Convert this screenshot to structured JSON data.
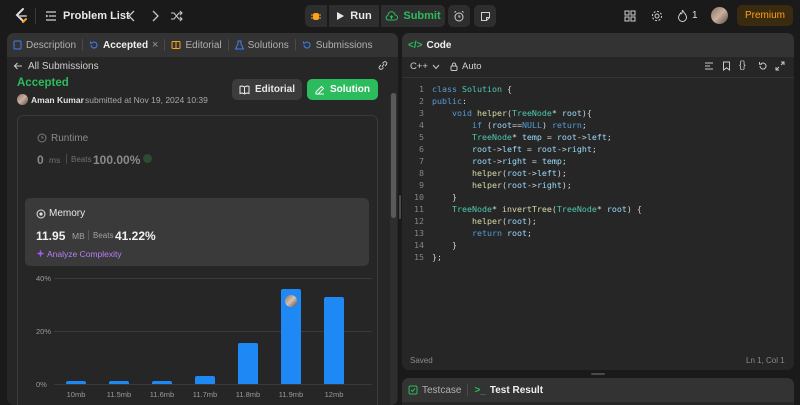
{
  "nav": {
    "problem_list": "Problem List",
    "run": "Run",
    "submit": "Submit",
    "streak": "1",
    "premium": "Premium"
  },
  "left_tabs": [
    {
      "label": "Description"
    },
    {
      "label": "Accepted"
    },
    {
      "label": "Editorial"
    },
    {
      "label": "Solutions"
    },
    {
      "label": "Submissions"
    }
  ],
  "submission": {
    "back_label": "All Submissions",
    "status": "Accepted",
    "author": "Aman Kumar",
    "submitted_text": "submitted at Nov 19, 2024 10:39",
    "editorial_button": "Editorial",
    "solution_button": "Solution"
  },
  "runtime": {
    "title": "Runtime",
    "value": "0",
    "unit": "ms",
    "beats_label": "Beats",
    "beats_value": "100.00%"
  },
  "memory": {
    "title": "Memory",
    "value": "11.95",
    "unit": "MB",
    "beats_label": "Beats",
    "beats_value": "41.22%",
    "analyze": "Analyze Complexity"
  },
  "chart_data": {
    "type": "bar",
    "categories": [
      "10mb",
      "11.5mb",
      "11.6mb",
      "11.7mb",
      "11.8mb",
      "11.9mb",
      "12mb"
    ],
    "values": [
      0.8,
      0.8,
      0.8,
      3.2,
      15.5,
      36,
      33
    ],
    "ylim": [
      0,
      40
    ],
    "yticks": [
      "0%",
      "20%",
      "40%"
    ],
    "highlight_index": 5,
    "bar_color": "#1e88f5"
  },
  "code_panel": {
    "title": "Code",
    "language": "C++",
    "auto_label": "Auto",
    "saved": "Saved",
    "cursor": "Ln 1, Col 1"
  },
  "code_lines": [
    "1",
    "2",
    "3",
    "4",
    "5",
    "6",
    "7",
    "8",
    "9",
    "10",
    "11",
    "12",
    "13",
    "14",
    "15"
  ],
  "bottom_tabs": {
    "testcase": "Testcase",
    "result": "Test Result"
  },
  "colors": {
    "accent_green": "#2cbb5d",
    "accent_blue": "#1e88f5",
    "premium": "#ffa116",
    "accepted": "#2cbb5d"
  }
}
